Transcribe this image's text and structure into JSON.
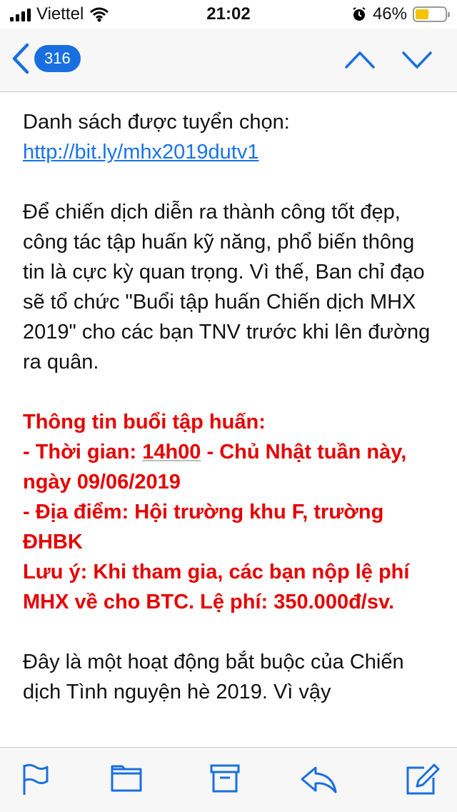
{
  "status_bar": {
    "carrier": "Viettel",
    "time": "21:02",
    "battery_percent": "46%",
    "battery_level": 0.46
  },
  "nav": {
    "back_count": "316"
  },
  "message": {
    "list_label": "Danh sách được tuyển chọn: ",
    "list_link": "http://bit.ly/mhx2019dutv1",
    "paragraph1": "Để chiến dịch diễn ra thành công tốt đẹp, công tác tập huấn kỹ năng, phổ biến thông tin là cực kỳ quan trọng. Vì thế, Ban chỉ đạo sẽ tổ chức \"Buổi tập huấn Chiến dịch MHX 2019\" cho các bạn TNV trước khi lên đường ra quân.",
    "info_title": "Thông tin buổi tập huấn:",
    "time_prefix": "- Thời gian: ",
    "time_value": "14h00",
    "time_suffix": " - Chủ Nhật tuần này, ngày 09/06/2019",
    "location": "- Địa điểm: Hội trường khu F, trường ĐHBK",
    "note": "Lưu ý: Khi tham gia, các bạn nộp lệ phí MHX về cho BTC. Lệ phí: 350.000đ/sv.",
    "paragraph3": "Đây là một hoạt động bắt buộc của Chiến dịch Tình nguyện hè 2019. Vì vậy"
  },
  "toolbar": {
    "icons": [
      "flag-icon",
      "folder-icon",
      "archive-icon",
      "reply-icon",
      "compose-icon"
    ]
  },
  "colors": {
    "accent": "#1a6fe0",
    "highlight_red": "#e60000",
    "link": "#1a73e8"
  }
}
